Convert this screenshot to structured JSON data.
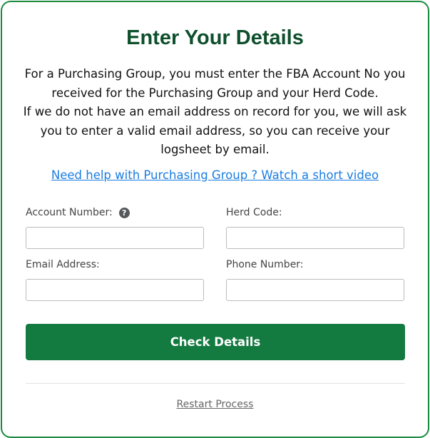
{
  "form": {
    "title": "Enter Your Details",
    "intro_line1": "For a Purchasing Group, you must enter the FBA Account No you received for the Purchasing Group and your Herd Code.",
    "intro_line2": "If we do not have an email address on record for you, we will ask you to enter a valid email address, so you can receive your logsheet by email.",
    "help_link": "Need help with Purchasing Group ? Watch a short video",
    "fields": {
      "account_number": {
        "label": "Account Number:",
        "value": "",
        "help_icon": "question-circle-icon"
      },
      "herd_code": {
        "label": "Herd Code:",
        "value": ""
      },
      "email_address": {
        "label": "Email Address:",
        "value": ""
      },
      "phone_number": {
        "label": "Phone Number:",
        "value": ""
      }
    },
    "submit_label": "Check Details",
    "restart_label": "Restart Process"
  },
  "colors": {
    "border": "#1d8a40",
    "title": "#0e4f2c",
    "button": "#137a40",
    "link": "#1a7de0"
  }
}
